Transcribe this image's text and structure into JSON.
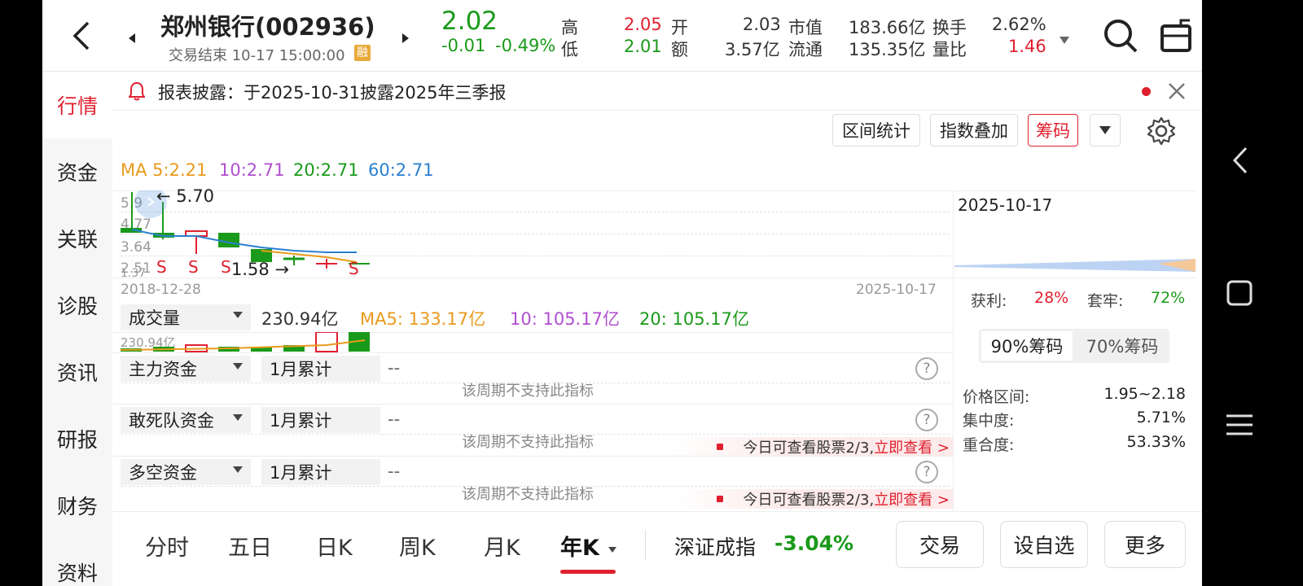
{
  "header": {
    "stock_name": "郑州银行(002936)",
    "status": "交易结束 10-17 15:00:00",
    "status_badge": "融",
    "price": "2.02",
    "change": "-0.01",
    "change_pct": "-0.49%",
    "high_label": "高",
    "high_value": "2.05",
    "low_label": "低",
    "low_value": "2.01",
    "open_label": "开",
    "open_value": "2.03",
    "amount_label": "额",
    "amount_value": "3.57亿",
    "mcap_label": "市值",
    "mcap_value": "183.66亿",
    "float_label": "流通",
    "float_value": "135.35亿",
    "turnover_label": "换手",
    "turnover_value": "2.62%",
    "volratio_label": "量比",
    "volratio_value": "1.46"
  },
  "sidebar": {
    "items": [
      {
        "label": "行情"
      },
      {
        "label": "资金"
      },
      {
        "label": "关联"
      },
      {
        "label": "诊股"
      },
      {
        "label": "资讯"
      },
      {
        "label": "研报"
      },
      {
        "label": "财务"
      },
      {
        "label": "资料"
      }
    ]
  },
  "notice": {
    "text": "报表披露：于2025-10-31披露2025年三季报"
  },
  "toolbar": {
    "range_stats": "区间统计",
    "index_overlay": "指数叠加",
    "chips": "筹码"
  },
  "ma": {
    "ma5": "MA 5:2.21",
    "ma10": "10:2.71",
    "ma20": "20:2.71",
    "ma60": "60:2.71"
  },
  "kline": {
    "max_label": "5.70",
    "min_label": "1.58",
    "axis": [
      "5.9",
      "4.77",
      "3.64",
      "2.51",
      "1.37"
    ],
    "date_start": "2018-12-28",
    "date_end": "2025-10-17",
    "marker": "S"
  },
  "volume": {
    "selector": "成交量",
    "value": "230.94亿",
    "ma5": "MA5: 133.17亿",
    "ma10": "10: 105.17亿",
    "ma20": "20: 105.17亿",
    "axis": "230.94亿"
  },
  "indicators": [
    {
      "name": "主力资金",
      "period": "1月累计",
      "value": "--",
      "note": "该周期不支持此指标",
      "lock": ""
    },
    {
      "name": "敢死队资金",
      "period": "1月累计",
      "value": "--",
      "note": "该周期不支持此指标",
      "lock": "今日可查看股票2/3,"
    },
    {
      "name": "多空资金",
      "period": "1月累计",
      "value": "--",
      "note": "该周期不支持此指标",
      "lock": "今日可查看股票2/3,"
    }
  ],
  "lock_link": "立即查看 >",
  "chips_panel": {
    "date": "2025-10-17",
    "profit_label": "获利:",
    "profit_value": "28%",
    "trapped_label": "套牢:",
    "trapped_value": "72%",
    "tab90": "90%筹码",
    "tab70": "70%筹码",
    "range_label": "价格区间:",
    "range_value": "1.95~2.18",
    "concentration_label": "集中度:",
    "concentration_value": "5.71%",
    "overlap_label": "重合度:",
    "overlap_value": "53.33%"
  },
  "bottom": {
    "tabs": [
      "分时",
      "五日",
      "日K",
      "周K",
      "月K",
      "年K"
    ],
    "index_name": "深证成指",
    "index_change": "-3.04%",
    "trade": "交易",
    "add_watch": "设自选",
    "more": "更多"
  }
}
